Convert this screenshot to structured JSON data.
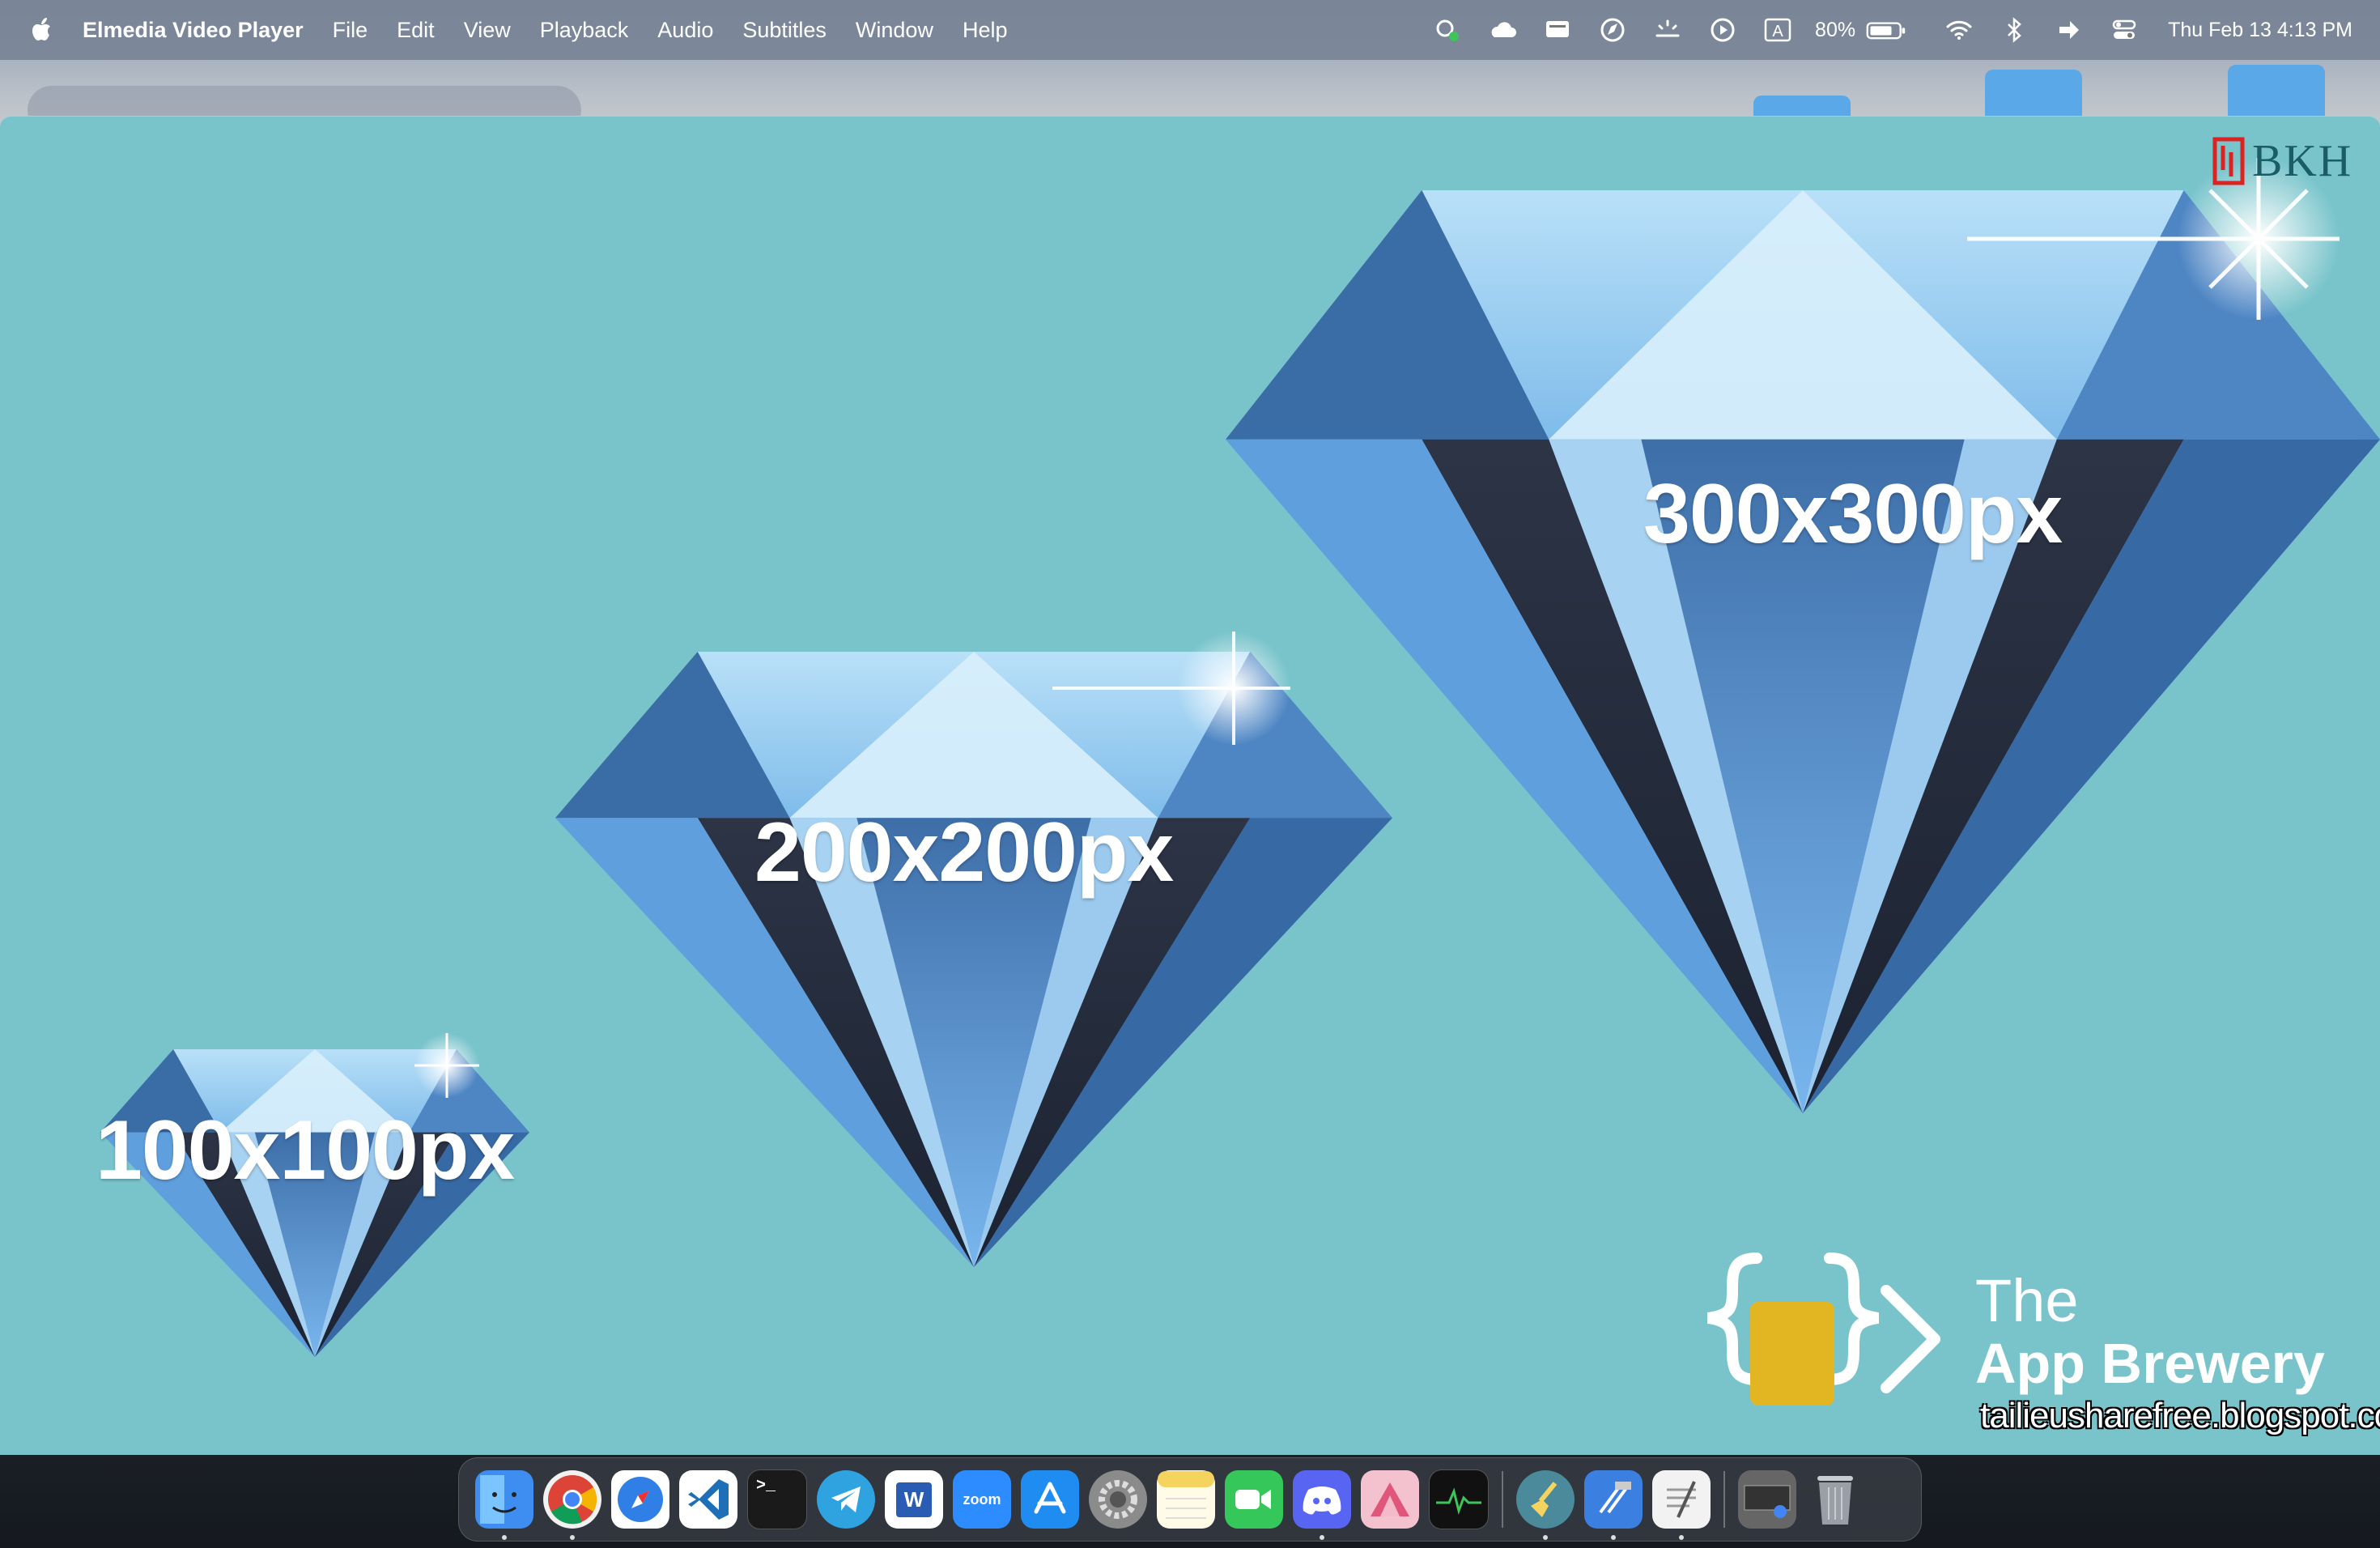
{
  "menubar": {
    "app_name": "Elmedia Video Player",
    "menus": [
      "File",
      "Edit",
      "View",
      "Playback",
      "Audio",
      "Subtitles",
      "Window",
      "Help"
    ],
    "input_source": "A",
    "battery": "80%",
    "clock": "Thu Feb 13  4:13 PM",
    "icons": [
      "creative-cloud-icon",
      "icloud-icon",
      "display-icon",
      "compass-icon",
      "brightness-icon",
      "play-icon",
      "input-source-icon",
      "battery-icon",
      "wifi-icon",
      "bluetooth-icon",
      "arrow-icon",
      "control-center-icon"
    ]
  },
  "video": {
    "labels": {
      "small": "100x100px",
      "medium": "200x200px",
      "large": "300x300px"
    },
    "watermark_top": "BKH",
    "brand_line1": "The",
    "brand_line2": "App Brewery",
    "blog": "tailieusharefree.blogspot.com",
    "colors": {
      "background": "#79c4cb",
      "gem_light": "#9fd0f2",
      "gem_mid": "#4f8fcb",
      "gem_dark": "#2a3446"
    }
  },
  "dock": {
    "apps": [
      {
        "name": "finder",
        "color": "#3d8ef0"
      },
      {
        "name": "chrome",
        "color": "#e8e8e8"
      },
      {
        "name": "safari",
        "color": "#2f7fe6"
      },
      {
        "name": "vscode",
        "color": "#1f6fb8"
      },
      {
        "name": "terminal",
        "color": "#1a1a1a",
        "label": ">_"
      },
      {
        "name": "telegram",
        "color": "#2ea3df"
      },
      {
        "name": "word",
        "color": "#2b5cb4",
        "label": "W"
      },
      {
        "name": "zoom",
        "color": "#2d8cff",
        "label": "zoom"
      },
      {
        "name": "app-store",
        "color": "#1e8cf0"
      },
      {
        "name": "system-settings",
        "color": "#8b8b8b"
      },
      {
        "name": "notes",
        "color": "#f4d35e"
      },
      {
        "name": "facetime",
        "color": "#35c759"
      },
      {
        "name": "discord",
        "color": "#5865f2"
      },
      {
        "name": "affinity",
        "color": "#e88ba6"
      },
      {
        "name": "activity-monitor",
        "color": "#222"
      },
      {
        "name": "cleaner",
        "color": "#4a8a9a"
      },
      {
        "name": "xcode",
        "color": "#3b7fe0"
      },
      {
        "name": "textedit",
        "color": "#f2f2f2"
      },
      {
        "name": "downloads-stack",
        "color": "#666"
      },
      {
        "name": "trash",
        "color": "#9a9ea6"
      }
    ]
  }
}
